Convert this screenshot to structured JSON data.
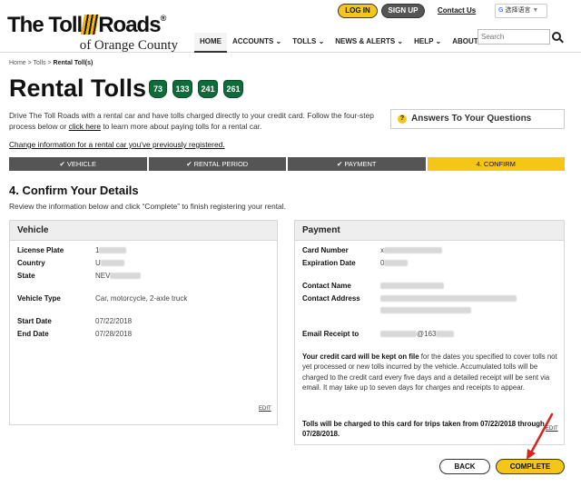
{
  "header": {
    "logo_main_1": "The Toll",
    "logo_main_2": "Roads",
    "logo_reg": "®",
    "logo_sub": "of Orange County",
    "login": "LOG IN",
    "signup": "SIGN UP",
    "contact": "Contact Us",
    "lang_g": "G",
    "lang": "选择语言",
    "lang_arrow": "▼",
    "search_placeholder": "Search",
    "nav": [
      {
        "label": "HOME"
      },
      {
        "label": "ACCOUNTS ⌄"
      },
      {
        "label": "TOLLS ⌄"
      },
      {
        "label": "NEWS & ALERTS ⌄"
      },
      {
        "label": "HELP ⌄"
      },
      {
        "label": "ABOUT TCA ⌄"
      }
    ]
  },
  "breadcrumb": {
    "home": "Home",
    "sep1": " > ",
    "tolls": "Tolls",
    "sep2": " > ",
    "current": "Rental Toll(s)"
  },
  "page": {
    "title": "Rental Tolls",
    "shields": [
      "73",
      "133",
      "241",
      "261"
    ],
    "intro_1": "Drive The Toll Roads with a rental car and have tolls charged directly to your credit card. Follow the four-step process below or ",
    "intro_link": "click here",
    "intro_2": " to learn more about paying tolls for a rental car.",
    "change_link": "Change information for a rental car you've previously registered.",
    "answers": "Answers To Your Questions",
    "answers_icon": "?"
  },
  "steps": [
    {
      "label": "✔  VEHICLE"
    },
    {
      "label": "✔  RENTAL PERIOD"
    },
    {
      "label": "✔  PAYMENT"
    },
    {
      "label": "4. CONFIRM"
    }
  ],
  "confirm": {
    "title": "4. Confirm Your Details",
    "desc": "Review the information below and click “Complete” to finish registering your rental."
  },
  "vehicle": {
    "heading": "Vehicle",
    "license_plate_label": "License Plate",
    "license_plate_value": "1",
    "country_label": "Country",
    "country_value": "U",
    "state_label": "State",
    "state_value": "NEV",
    "vehicle_type_label": "Vehicle Type",
    "vehicle_type_value": "Car, motorcycle, 2-axle truck",
    "start_date_label": "Start Date",
    "start_date_value": "07/22/2018",
    "end_date_label": "End Date",
    "end_date_value": "07/28/2018",
    "edit": "EDIT"
  },
  "payment": {
    "heading": "Payment",
    "card_number_label": "Card Number",
    "card_number_value": "x",
    "expiration_label": "Expiration Date",
    "expiration_value": "0",
    "contact_name_label": "Contact Name",
    "contact_address_label": "Contact Address",
    "email_label": "Email Receipt to",
    "email_value": "@163",
    "note_bold": "Your credit card will be kept on file",
    "note_rest": " for the dates you specified to cover tolls not yet processed or new tolls incurred by the vehicle. Accumulated tolls will be charged to the credit card every five days and a detailed receipt will be sent via email. It may take up to seven days for charges and receipts to appear.",
    "note2": "Tolls will be charged to this card for trips taken from 07/22/2018 through 07/28/2018.",
    "edit": "EDIT"
  },
  "actions": {
    "back": "BACK",
    "complete": "COMPLETE"
  },
  "colors": {
    "accent": "#f5c518",
    "step_done": "#555555",
    "shield": "#0f6b3a",
    "arrow": "#d9231d"
  }
}
